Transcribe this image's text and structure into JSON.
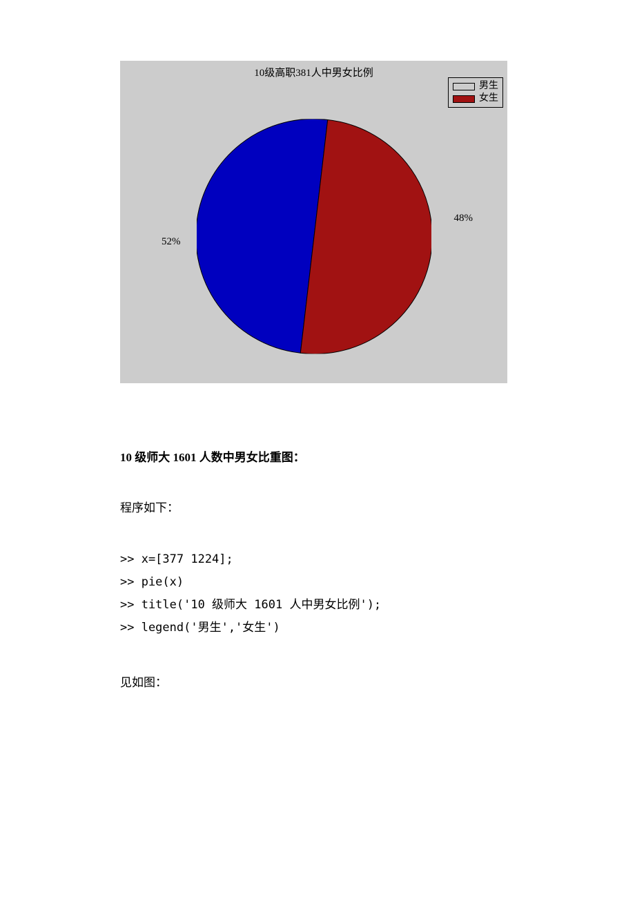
{
  "chart_data": {
    "type": "pie",
    "title": "10级高职381人中男女比例",
    "categories": [
      "男生",
      "女生"
    ],
    "values": [
      52,
      48
    ],
    "labels": [
      "52%",
      "48%"
    ],
    "colors": [
      "#0000bf",
      "#a11212"
    ],
    "legend_position": "top-right"
  },
  "legend": {
    "items": [
      {
        "label": "男生",
        "color": "#0000bf"
      },
      {
        "label": "女生",
        "color": "#a11212"
      }
    ]
  },
  "pie_labels": {
    "left": "52%",
    "right": "48%"
  },
  "doc": {
    "heading": "10 级师大 1601 人数中男女比重图：",
    "intro": "程序如下：",
    "code1": ">> x=[377 1224];",
    "code2": ">> pie(x)",
    "code3": ">> title('10 级师大 1601 人中男女比例');",
    "code4": ">> legend('男生','女生')",
    "closing": "见如图："
  }
}
